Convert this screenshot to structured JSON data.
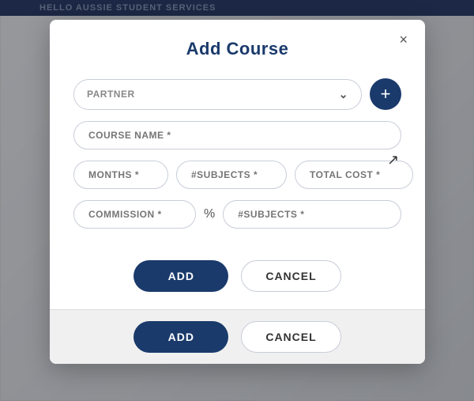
{
  "background": {
    "topbar_text": "HELLO AUSSIE STUDENT SERVICES"
  },
  "modal": {
    "title": "Add Course",
    "close_label": "×",
    "fields": {
      "partner_placeholder": "PARTNER",
      "course_name_placeholder": "COURSE NAME *",
      "months_placeholder": "MONTHS *",
      "subjects1_placeholder": "#SUBJECTS *",
      "total_cost_placeholder": "TOTAL COST *",
      "commission_placeholder": "COMMISSION *",
      "percent_label": "%",
      "subjects2_placeholder": "#SUBJECTS *"
    },
    "footer": {
      "add_label": "ADD",
      "cancel_label": "CANCEL",
      "add_label_sticky": "ADD",
      "cancel_label_sticky": "CANCEL"
    }
  }
}
